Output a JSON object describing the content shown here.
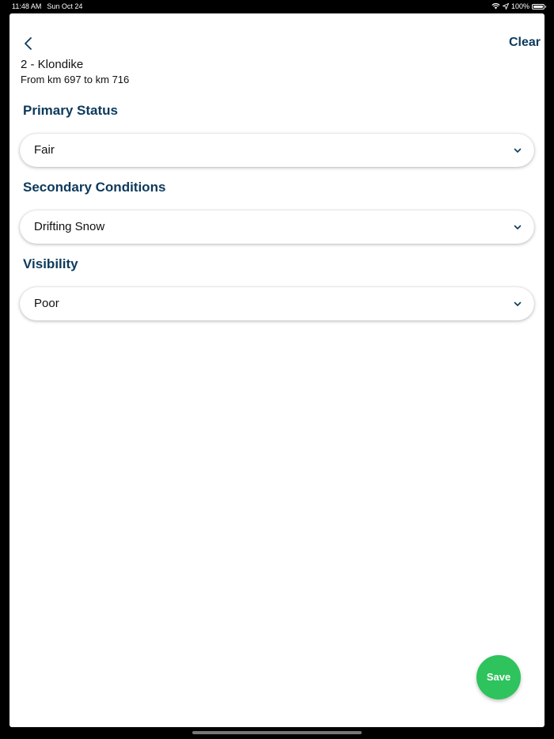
{
  "status_bar": {
    "time": "11:48 AM",
    "date": "Sun Oct 24",
    "battery": "100%",
    "battery_level": 1.0,
    "icons": [
      "wifi-icon",
      "location-arrow-icon",
      "battery-icon"
    ]
  },
  "header": {
    "back_icon": "chevron-left-icon",
    "clear_label": "Clear"
  },
  "segment": {
    "title": "2 - Klondike",
    "range": "From km 697 to km 716"
  },
  "sections": [
    {
      "heading": "Primary Status",
      "value": "Fair"
    },
    {
      "heading": "Secondary Conditions",
      "value": "Drifting Snow"
    },
    {
      "heading": "Visibility",
      "value": "Poor"
    }
  ],
  "save_label": "Save",
  "colors": {
    "accent": "#0c3a5c",
    "save": "#2ec35c",
    "background": "#ffffff"
  }
}
